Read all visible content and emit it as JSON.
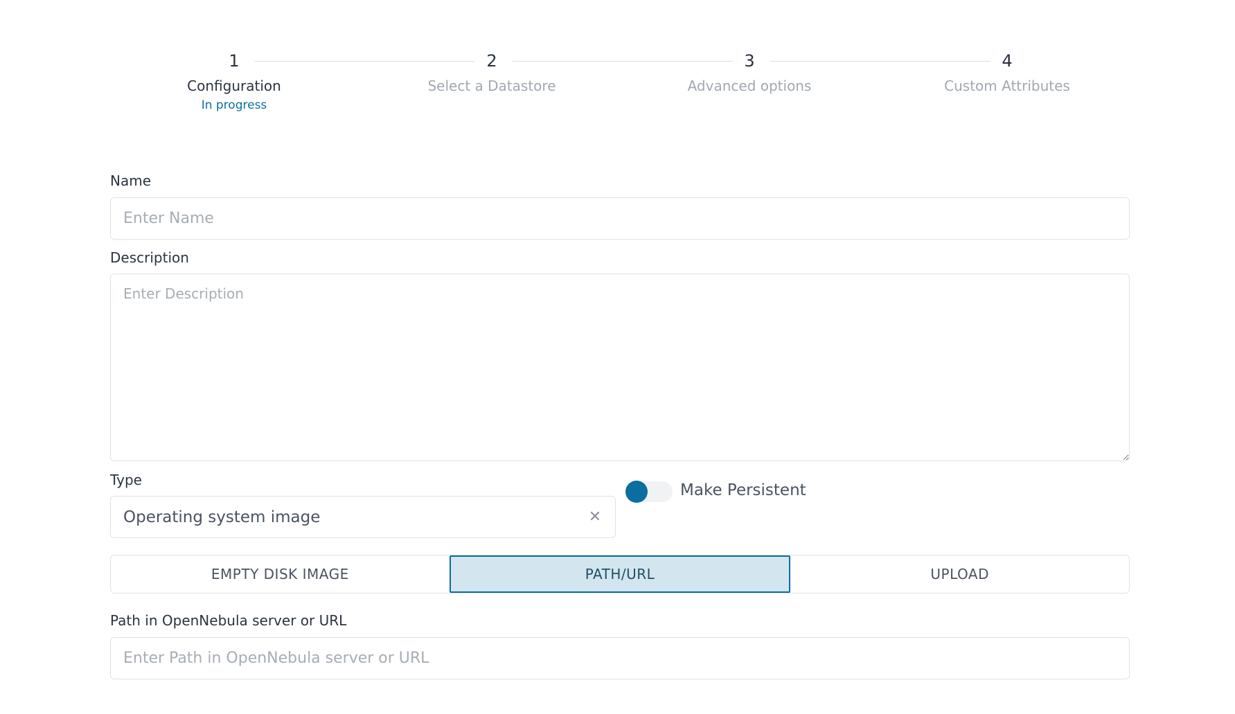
{
  "stepper": {
    "steps": [
      {
        "number": "1",
        "label": "Configuration",
        "status": "In progress",
        "active": true
      },
      {
        "number": "2",
        "label": "Select a Datastore",
        "active": false
      },
      {
        "number": "3",
        "label": "Advanced options",
        "active": false
      },
      {
        "number": "4",
        "label": "Custom Attributes",
        "active": false
      }
    ]
  },
  "form": {
    "name": {
      "label": "Name",
      "placeholder": "Enter Name",
      "value": ""
    },
    "description": {
      "label": "Description",
      "placeholder": "Enter Description",
      "value": ""
    },
    "type": {
      "label": "Type",
      "value": "Operating system image",
      "clear_icon": "close-icon"
    },
    "persistent": {
      "label": "Make Persistent",
      "checked": false,
      "accent": "#0a6ea0"
    },
    "source_tabs": {
      "options": [
        "EMPTY DISK IMAGE",
        "PATH/URL",
        "UPLOAD"
      ],
      "selected": "PATH/URL"
    },
    "path": {
      "label": "Path in OpenNebula server or URL",
      "placeholder": "Enter Path in OpenNebula server or URL",
      "value": ""
    }
  },
  "colors": {
    "accent": "#0a6ea0",
    "selected_tab_bg": "#d3e5ee",
    "muted_text": "#a1a8b0"
  }
}
